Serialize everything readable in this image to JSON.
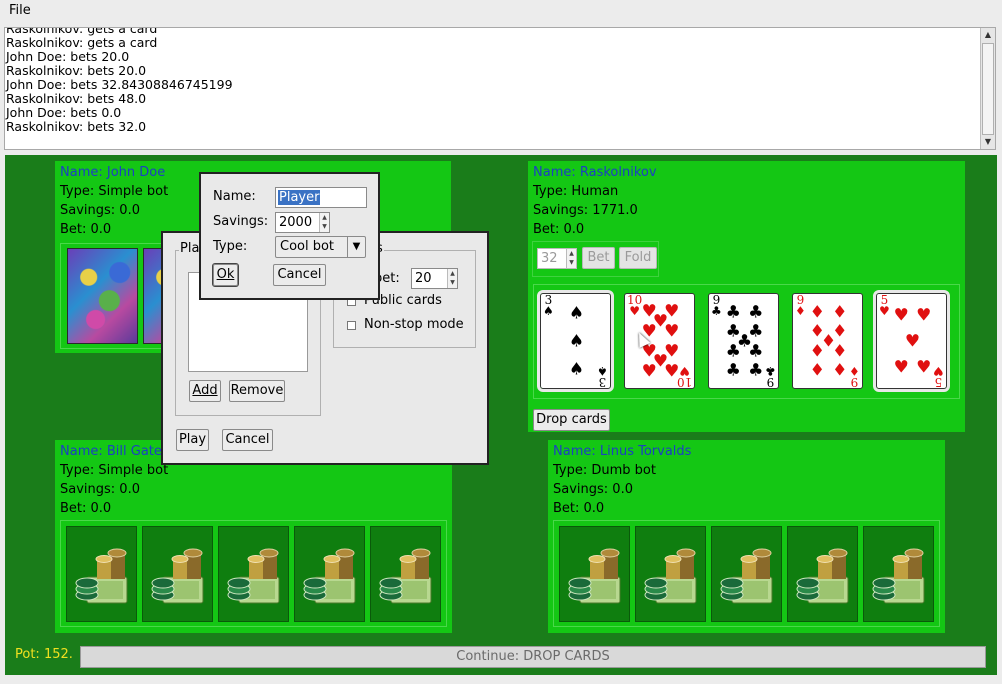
{
  "menu": {
    "file": "File"
  },
  "log": [
    "Raskolnikov: gets a card",
    "Raskolnikov: gets a card",
    "John Doe: bets 20.0",
    "Raskolnikov: bets 20.0",
    "John Doe: bets 32.84308846745199",
    "Raskolnikov: bets 48.0",
    "John Doe: bets 0.0",
    "Raskolnikov: bets 32.0"
  ],
  "players": {
    "john": {
      "name": "Name: John Doe",
      "type": "Type: Simple bot",
      "savings": "Savings: 0.0",
      "bet": "Bet: 0.0"
    },
    "rask": {
      "name": "Name: Raskolnikov",
      "type": "Type: Human",
      "savings": "Savings: 1771.0",
      "bet": "Bet: 0.0",
      "bet_value": "32",
      "bet_btn": "Bet",
      "fold_btn": "Fold",
      "drop_btn": "Drop cards",
      "cards": [
        {
          "rank": "3",
          "suit": "♠",
          "color": "blk"
        },
        {
          "rank": "10",
          "suit": "♥",
          "color": "red"
        },
        {
          "rank": "9",
          "suit": "♣",
          "color": "blk"
        },
        {
          "rank": "9",
          "suit": "♦",
          "color": "red"
        },
        {
          "rank": "5",
          "suit": "♥",
          "color": "red"
        }
      ]
    },
    "bill": {
      "name": "Name: Bill Gates",
      "type": "Type: Simple bot",
      "savings": "Savings: 0.0",
      "bet": "Bet: 0.0"
    },
    "linus": {
      "name": "Name: Linus Torvalds",
      "type": "Type: Dumb bot",
      "savings": "Savings: 0.0",
      "bet": "Bet: 0.0"
    }
  },
  "pot": "Pot: 152.",
  "continue_btn": "Continue: DROP CARDS",
  "setup_dialog": {
    "players_group": "Pla",
    "options_group": "s",
    "add_btn": "Add",
    "remove_btn": "Remove",
    "bet_label": "bet:",
    "bet_value": "20",
    "public_cards": "Public cards",
    "nonstop": "Non-stop mode",
    "play_btn": "Play",
    "cancel_btn": "Cancel"
  },
  "player_dialog": {
    "name_label": "Name:",
    "name_value": "Player",
    "savings_label": "Savings:",
    "savings_value": "2000",
    "type_label": "Type:",
    "type_value": "Cool bot",
    "ok_btn": "Ok",
    "cancel_btn": "Cancel"
  },
  "colors": {
    "table": "#1a7d1a",
    "panel": "#14c714",
    "name": "#1c3fc4",
    "pot": "#f0e020"
  }
}
